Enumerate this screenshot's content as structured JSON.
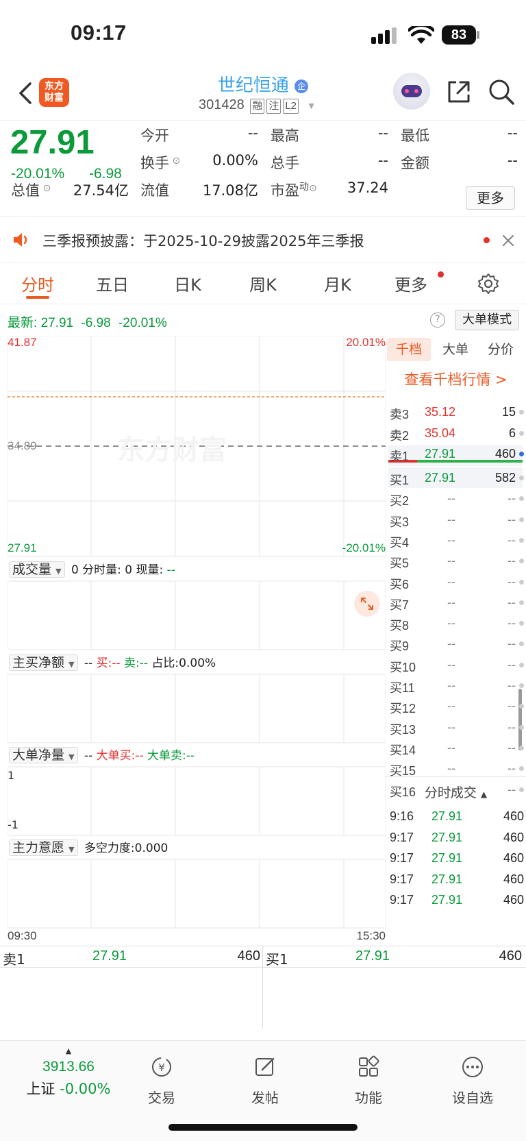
{
  "status": {
    "time": "09:17",
    "battery": "83"
  },
  "header": {
    "logo": "东方财富",
    "stock_name": "世纪恒通",
    "stock_code": "301428",
    "tags": [
      "融",
      "注",
      "L2"
    ]
  },
  "quote": {
    "price": "27.91",
    "change_pct": "-20.01%",
    "change": "-6.98",
    "stats": [
      {
        "label": "今开",
        "value": "--"
      },
      {
        "label": "最高",
        "value": "--"
      },
      {
        "label": "最低",
        "value": "--"
      },
      {
        "label": "换手",
        "value": "0.00%"
      },
      {
        "label": "总手",
        "value": "--"
      },
      {
        "label": "金额",
        "value": "--"
      },
      {
        "label": "总值",
        "value": "27.54亿"
      },
      {
        "label": "流值",
        "value": "17.08亿"
      },
      {
        "label": "市盈",
        "value": "37.24"
      }
    ],
    "pe_superscript": "动",
    "more": "更多"
  },
  "notice": {
    "text": "三季报预披露：于2025-10-29披露2025年三季报"
  },
  "tabs": [
    "分时",
    "五日",
    "日K",
    "周K",
    "月K",
    "更多"
  ],
  "chart_info": {
    "latest_label": "最新:",
    "latest_price": "27.91",
    "latest_change": "-6.98",
    "latest_pct": "-20.01%",
    "big_order_mode": "大单模式"
  },
  "chart_data": {
    "type": "line",
    "y_top": "41.87",
    "y_mid": "34.89",
    "y_bottom": "27.91",
    "pct_top": "20.01%",
    "pct_bottom": "-20.01%",
    "x_start": "09:30",
    "x_end": "15:30",
    "prev_close": 34.89,
    "limit_up_line": 41.87,
    "limit_down": 27.91,
    "watermark": "东方财富"
  },
  "panes": {
    "volume": {
      "label": "成交量",
      "text": "0 分时量: 0 现量:",
      "value": "--"
    },
    "net_buy": {
      "label": "主买净额",
      "dash": "--",
      "buy": "买:--",
      "sell": "卖:--",
      "ratio": "占比:0.00%"
    },
    "big_net": {
      "label": "大单净量",
      "dash": "--",
      "buy": "大单买:--",
      "sell": "大单卖:--",
      "y_top": "1",
      "y_bottom": "-1"
    },
    "main_force": {
      "label": "主力意愿",
      "text": "多空力度:0.000"
    }
  },
  "book": {
    "tabs": [
      "千档",
      "大单",
      "分价"
    ],
    "link": "查看千档行情 >",
    "asks": [
      {
        "label": "卖3",
        "price": "35.12",
        "vol": "15"
      },
      {
        "label": "卖2",
        "price": "35.04",
        "vol": "6"
      },
      {
        "label": "卖1",
        "price": "27.91",
        "vol": "460"
      }
    ],
    "bids": [
      {
        "label": "买1",
        "price": "27.91",
        "vol": "582"
      },
      {
        "label": "买2",
        "price": "--",
        "vol": "--"
      },
      {
        "label": "买3",
        "price": "--",
        "vol": "--"
      },
      {
        "label": "买4",
        "price": "--",
        "vol": "--"
      },
      {
        "label": "买5",
        "price": "--",
        "vol": "--"
      },
      {
        "label": "买6",
        "price": "--",
        "vol": "--"
      },
      {
        "label": "买7",
        "price": "--",
        "vol": "--"
      },
      {
        "label": "买8",
        "price": "--",
        "vol": "--"
      },
      {
        "label": "买9",
        "price": "--",
        "vol": "--"
      },
      {
        "label": "买10",
        "price": "--",
        "vol": "--"
      },
      {
        "label": "买11",
        "price": "--",
        "vol": "--"
      },
      {
        "label": "买12",
        "price": "--",
        "vol": "--"
      },
      {
        "label": "买13",
        "price": "--",
        "vol": "--"
      },
      {
        "label": "买14",
        "price": "--",
        "vol": "--"
      },
      {
        "label": "买15",
        "price": "--",
        "vol": "--"
      },
      {
        "label": "买16",
        "price": "--",
        "vol": "--"
      }
    ],
    "ticks_title": "分时成交",
    "ticks": [
      {
        "time": "9:16",
        "price": "27.91",
        "vol": "460"
      },
      {
        "time": "9:17",
        "price": "27.91",
        "vol": "460"
      },
      {
        "time": "9:17",
        "price": "27.91",
        "vol": "460"
      },
      {
        "time": "9:17",
        "price": "27.91",
        "vol": "460"
      },
      {
        "time": "9:17",
        "price": "27.91",
        "vol": "460"
      }
    ]
  },
  "level1": {
    "sell_label": "卖1",
    "sell_price": "27.91",
    "sell_vol": "460",
    "buy_label": "买1",
    "buy_price": "27.91",
    "buy_vol": "460"
  },
  "nav": {
    "index_value": "3913.66",
    "index_name": "上证",
    "index_pct": "-0.00%",
    "items": [
      "交易",
      "发帖",
      "功能",
      "设自选"
    ]
  }
}
